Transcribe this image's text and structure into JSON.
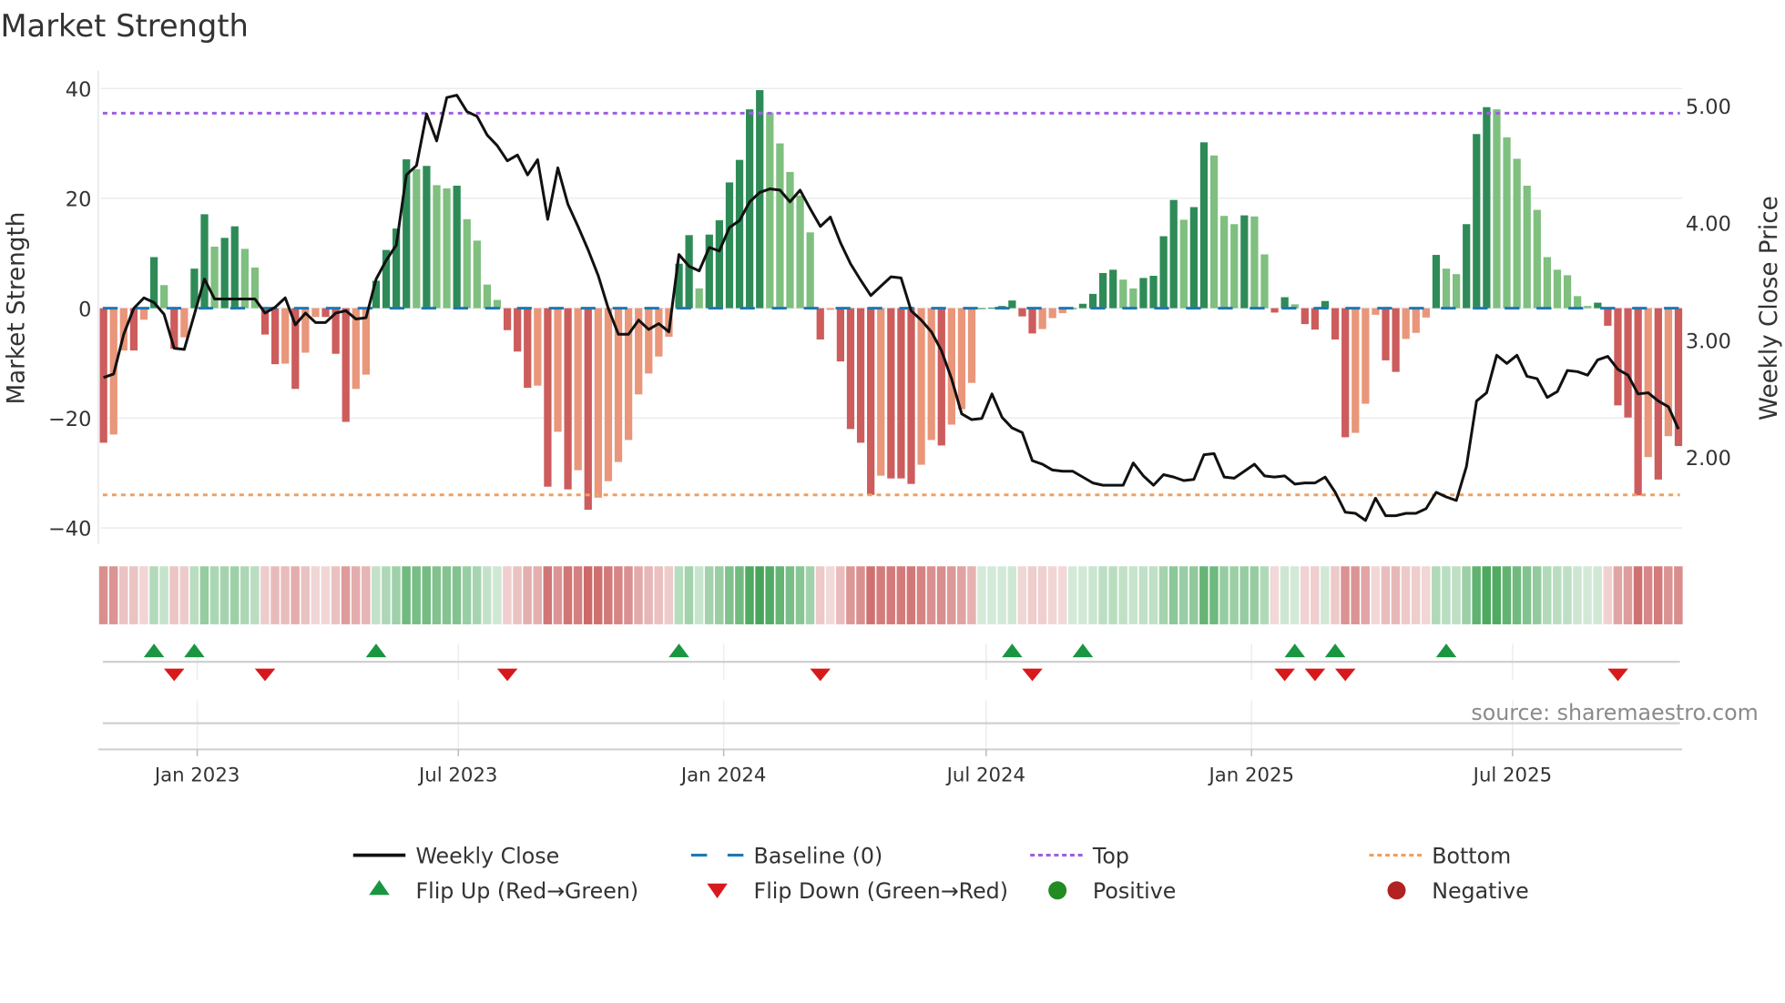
{
  "chart_data": {
    "type": "bar",
    "title": "Market Strength",
    "ylabel": "Market Strength",
    "y2label": "Weekly Close Price",
    "source": "source: sharemaestro.com",
    "frequency": "weekly",
    "start_date": "2022-10-28",
    "ylim": [
      -42,
      42
    ],
    "y2lim": [
      1.35,
      5.15
    ],
    "yticks": [
      "40",
      "20",
      "0",
      "−20",
      "−40"
    ],
    "ytick_values": [
      40,
      20,
      0,
      -20,
      -40
    ],
    "y2ticks": [
      "5.00",
      "4.00",
      "3.00",
      "2.00"
    ],
    "y2tick_values": [
      5,
      4,
      3,
      2
    ],
    "xticks": [
      {
        "label": "Jan 2023",
        "date": "2023-01-01"
      },
      {
        "label": "Jul 2023",
        "date": "2023-07-01"
      },
      {
        "label": "Jan 2024",
        "date": "2024-01-01"
      },
      {
        "label": "Jul 2024",
        "date": "2024-07-01"
      },
      {
        "label": "Jan 2025",
        "date": "2025-01-01"
      },
      {
        "label": "Jul 2025",
        "date": "2025-07-01"
      }
    ],
    "reference_lines": {
      "baseline": 0,
      "top": 35.5,
      "bottom": -34
    },
    "strength": [
      -24.5,
      -23,
      -7.7,
      -7.7,
      -2.1,
      9.3,
      4.2,
      -7.4,
      -5.3,
      7.2,
      17.1,
      11.2,
      12.8,
      14.9,
      10.8,
      7.4,
      -4.8,
      -10.2,
      -10.1,
      -14.7,
      -8.1,
      -1.6,
      -1.6,
      -8.3,
      -20.7,
      -14.7,
      -12.1,
      5.0,
      10.6,
      14.5,
      27.1,
      25.3,
      25.9,
      22.4,
      21.8,
      22.3,
      16.2,
      12.3,
      4.3,
      1.5,
      -4.0,
      -7.9,
      -14.5,
      -14.1,
      -32.5,
      -22.5,
      -33,
      -29.5,
      -36.7,
      -34.5,
      -31.5,
      -28,
      -24,
      -15.7,
      -11.9,
      -8.8,
      -5.2,
      8.1,
      13.3,
      3.6,
      13.4,
      16.0,
      22.9,
      27.0,
      36.2,
      39.7,
      35.6,
      30.0,
      24.8,
      20.5,
      13.8,
      -5.7,
      -0.3,
      -9.7,
      -22,
      -24.5,
      -34,
      -30.5,
      -31,
      -31,
      -32,
      -28.5,
      -24,
      -25,
      -21.2,
      -18.4,
      -13.6,
      0.0,
      0.1,
      0.4,
      1.4,
      -1.5,
      -4.6,
      -3.8,
      -1.8,
      -0.9,
      0.0,
      0.8,
      2.6,
      6.4,
      7.0,
      5.2,
      3.6,
      5.5,
      5.9,
      13.1,
      19.7,
      16.1,
      18.4,
      30.2,
      27.8,
      16.8,
      15.3,
      16.9,
      16.7,
      9.8,
      -0.8,
      2.0,
      0.7,
      -2.9,
      -3.9,
      1.3,
      -5.7,
      -23.5,
      -22.7,
      -17.4,
      -1.2,
      -9.5,
      -11.6,
      -5.6,
      -4.5,
      -1.7,
      9.7,
      7.2,
      6.2,
      15.3,
      31.7,
      36.6,
      36.2,
      31.1,
      27.2,
      22.3,
      17.9,
      9.3,
      7.0,
      6.0,
      2.2,
      0.4,
      1.0,
      -3.2,
      -17.7,
      -19.9,
      -34.1,
      -27.1,
      -31.2,
      -23.3,
      -25.1
    ],
    "weekly_close": [
      2.68,
      2.71,
      3.05,
      3.27,
      3.36,
      3.32,
      3.22,
      2.93,
      2.92,
      3.22,
      3.52,
      3.35,
      3.35,
      3.35,
      3.35,
      3.35,
      3.23,
      3.28,
      3.36,
      3.13,
      3.23,
      3.15,
      3.15,
      3.23,
      3.25,
      3.18,
      3.19,
      3.52,
      3.68,
      3.81,
      4.41,
      4.49,
      4.93,
      4.7,
      5.07,
      5.09,
      4.95,
      4.91,
      4.75,
      4.66,
      4.53,
      4.58,
      4.41,
      4.54,
      4.03,
      4.47,
      4.16,
      3.97,
      3.77,
      3.55,
      3.27,
      3.05,
      3.05,
      3.17,
      3.09,
      3.14,
      3.07,
      3.73,
      3.63,
      3.59,
      3.79,
      3.76,
      3.96,
      4.02,
      4.18,
      4.26,
      4.29,
      4.28,
      4.18,
      4.28,
      4.12,
      3.97,
      4.05,
      3.83,
      3.65,
      3.51,
      3.38,
      3.46,
      3.54,
      3.53,
      3.25,
      3.17,
      3.07,
      2.91,
      2.67,
      2.37,
      2.32,
      2.33,
      2.54,
      2.34,
      2.25,
      2.21,
      1.97,
      1.94,
      1.89,
      1.88,
      1.88,
      1.83,
      1.78,
      1.76,
      1.76,
      1.76,
      1.95,
      1.84,
      1.76,
      1.85,
      1.83,
      1.8,
      1.81,
      2.02,
      2.03,
      1.83,
      1.82,
      1.88,
      1.94,
      1.84,
      1.83,
      1.84,
      1.77,
      1.78,
      1.78,
      1.83,
      1.7,
      1.53,
      1.52,
      1.46,
      1.65,
      1.5,
      1.5,
      1.52,
      1.52,
      1.56,
      1.7,
      1.66,
      1.63,
      1.92,
      2.48,
      2.55,
      2.87,
      2.8,
      2.87,
      2.69,
      2.67,
      2.51,
      2.56,
      2.74,
      2.73,
      2.7,
      2.83,
      2.86,
      2.75,
      2.7,
      2.54,
      2.55,
      2.48,
      2.43,
      2.24
    ],
    "flip_up_dates": [
      "2022-12-02",
      "2022-12-30",
      "2023-05-05",
      "2023-12-01",
      "2024-07-19",
      "2024-09-06",
      "2025-01-31",
      "2025-02-28",
      "2025-05-16"
    ],
    "flip_down_dates": [
      "2022-12-16",
      "2023-02-17",
      "2023-08-04",
      "2024-03-08",
      "2024-08-02",
      "2025-01-24",
      "2025-02-14",
      "2025-03-07",
      "2025-09-12"
    ],
    "colors": {
      "pos_rising": "#2e8b57",
      "pos_falling": "#7fbf7f",
      "neg_falling": "#cd5c5c",
      "neg_rising": "#e9967a",
      "close": "#111111",
      "baseline": "#1f77b4",
      "top": "#9d5fe0",
      "bottom": "#f0a060",
      "flip_up": "#1a9641",
      "flip_down": "#d7191c",
      "positive": "#228b22",
      "negative": "#b22222"
    },
    "legend": [
      {
        "label": "Weekly Close",
        "kind": "line"
      },
      {
        "label": "Baseline (0)",
        "kind": "dash"
      },
      {
        "label": "Top",
        "kind": "dot-top"
      },
      {
        "label": "Bottom",
        "kind": "dot-bottom"
      },
      {
        "label": "Flip Up (Red→Green)",
        "kind": "tri-up"
      },
      {
        "label": "Flip Down (Green→Red)",
        "kind": "tri-down"
      },
      {
        "label": "Positive",
        "kind": "circle-pos"
      },
      {
        "label": "Negative",
        "kind": "circle-neg"
      }
    ],
    "legend_placement": "bottom"
  }
}
